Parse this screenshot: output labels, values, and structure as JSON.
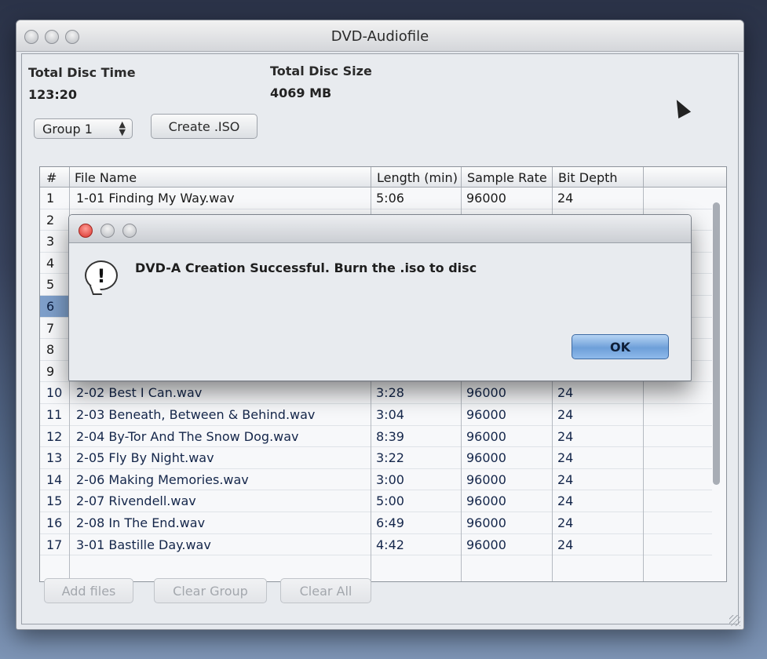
{
  "window": {
    "title": "DVD-Audiofile"
  },
  "summary": {
    "total_time_label": "Total Disc Time",
    "total_time_value": "123:20",
    "total_size_label": "Total Disc Size",
    "total_size_value": "4069 MB"
  },
  "toolbar": {
    "group_select": "Group 1",
    "create_iso": "Create .ISO"
  },
  "table": {
    "headers": [
      "#",
      "File Name",
      "Length (min)",
      "Sample Rate",
      "Bit Depth"
    ],
    "rows": [
      {
        "num": "1",
        "name": "1-01 Finding My Way.wav",
        "length": "5:06",
        "rate": "96000",
        "depth": "24"
      },
      {
        "num": "2",
        "name": "",
        "length": "",
        "rate": "",
        "depth": ""
      },
      {
        "num": "3",
        "name": "",
        "length": "",
        "rate": "",
        "depth": ""
      },
      {
        "num": "4",
        "name": "",
        "length": "",
        "rate": "",
        "depth": ""
      },
      {
        "num": "5",
        "name": "",
        "length": "",
        "rate": "",
        "depth": ""
      },
      {
        "num": "6",
        "name": "",
        "length": "",
        "rate": "",
        "depth": ""
      },
      {
        "num": "7",
        "name": "",
        "length": "",
        "rate": "",
        "depth": ""
      },
      {
        "num": "8",
        "name": "",
        "length": "",
        "rate": "",
        "depth": ""
      },
      {
        "num": "9",
        "name": "",
        "length": "",
        "rate": "",
        "depth": ""
      },
      {
        "num": "10",
        "name": "2-02 Best I Can.wav",
        "length": "3:28",
        "rate": "96000",
        "depth": "24"
      },
      {
        "num": "11",
        "name": "2-03 Beneath, Between & Behind.wav",
        "length": "3:04",
        "rate": "96000",
        "depth": "24"
      },
      {
        "num": "12",
        "name": "2-04 By-Tor And The Snow Dog.wav",
        "length": "8:39",
        "rate": "96000",
        "depth": "24"
      },
      {
        "num": "13",
        "name": "2-05 Fly By Night.wav",
        "length": "3:22",
        "rate": "96000",
        "depth": "24"
      },
      {
        "num": "14",
        "name": "2-06 Making Memories.wav",
        "length": "3:00",
        "rate": "96000",
        "depth": "24"
      },
      {
        "num": "15",
        "name": "2-07 Rivendell.wav",
        "length": "5:00",
        "rate": "96000",
        "depth": "24"
      },
      {
        "num": "16",
        "name": "2-08 In The End.wav",
        "length": "6:49",
        "rate": "96000",
        "depth": "24"
      },
      {
        "num": "17",
        "name": "3-01 Bastille Day.wav",
        "length": "4:42",
        "rate": "96000",
        "depth": "24"
      }
    ]
  },
  "bottom": {
    "add_files": "Add files",
    "clear_group": "Clear Group",
    "clear_all": "Clear All"
  },
  "dialog": {
    "message": "DVD-A Creation Successful. Burn the .iso to disc",
    "ok": "OK"
  }
}
